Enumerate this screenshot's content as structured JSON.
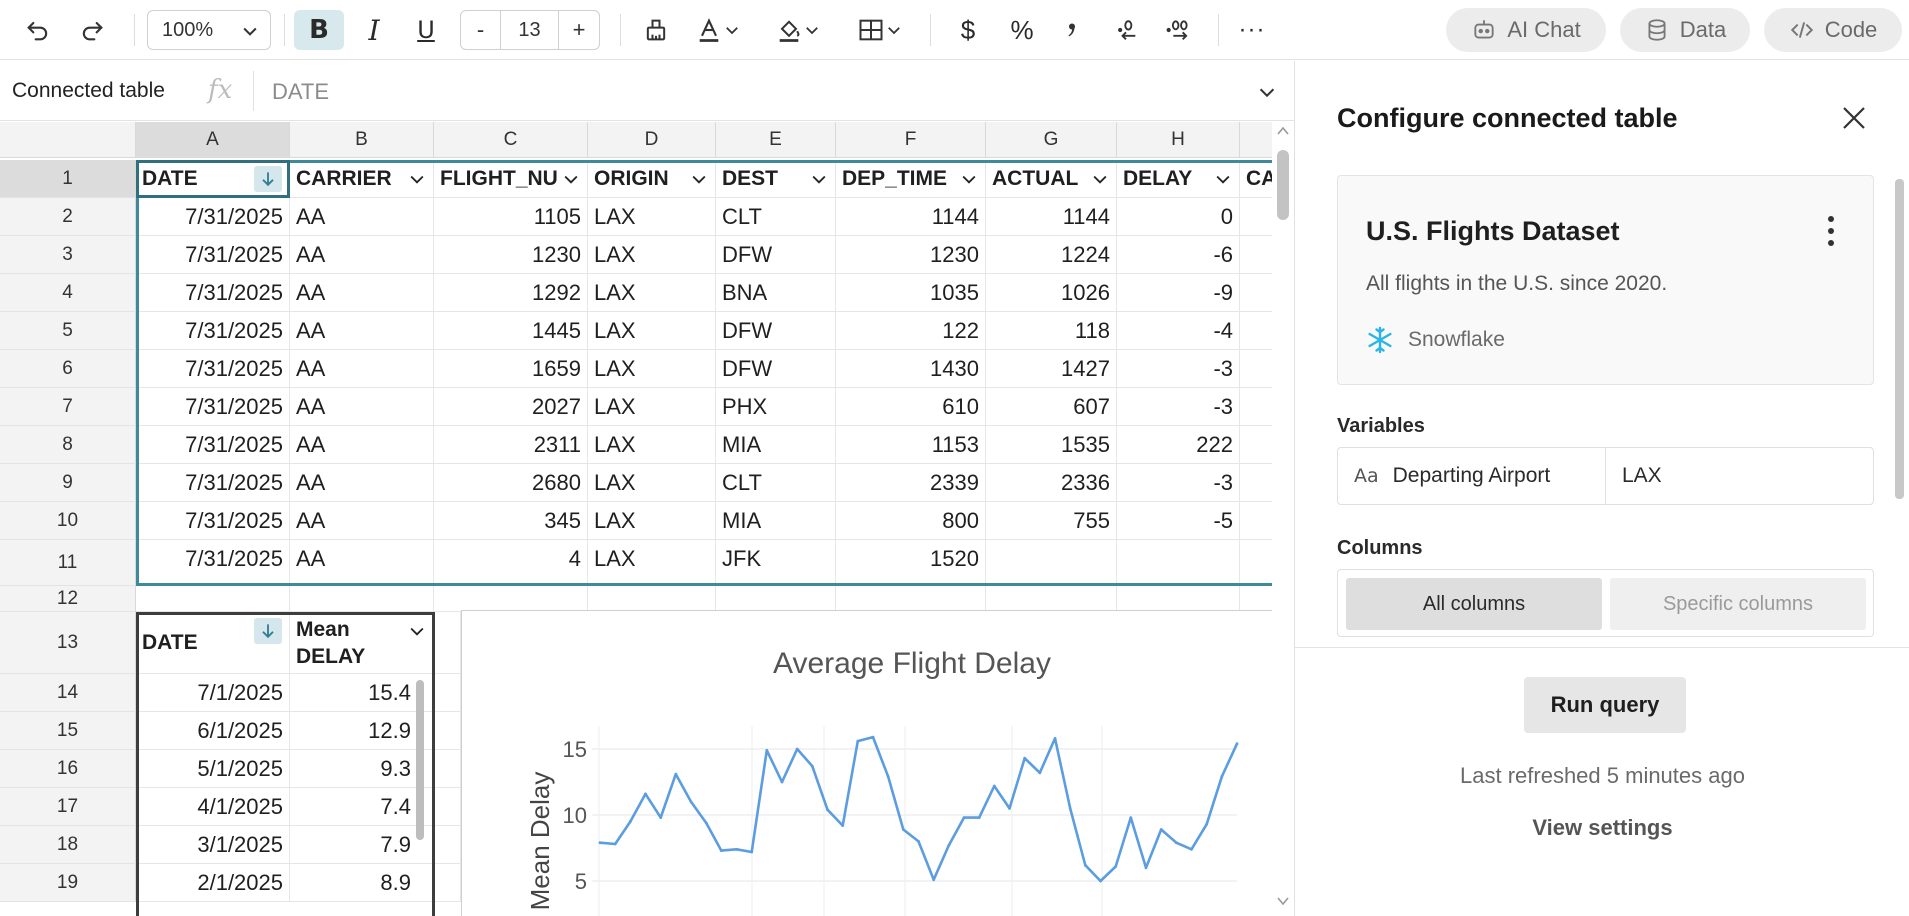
{
  "toolbar": {
    "zoom": "100%",
    "font_size": "13",
    "minus": "-",
    "plus": "+",
    "ai_chat": "AI Chat",
    "data": "Data",
    "code": "Code"
  },
  "formula_bar": {
    "name_box": "Connected table",
    "fx": "fx",
    "content": "DATE"
  },
  "columns": [
    "A",
    "B",
    "C",
    "D",
    "E",
    "F",
    "G",
    "H"
  ],
  "rows": [
    "1",
    "2",
    "3",
    "4",
    "5",
    "6",
    "7",
    "8",
    "9",
    "10",
    "11",
    "12",
    "13",
    "14",
    "15",
    "16",
    "17",
    "18",
    "19"
  ],
  "table1": {
    "headers": [
      "DATE",
      "CARRIER",
      "FLIGHT_NU",
      "ORIGIN",
      "DEST",
      "DEP_TIME",
      "ACTUAL",
      "DELAY",
      "CA"
    ],
    "rows": [
      [
        "7/31/2025",
        "AA",
        "1105",
        "LAX",
        "CLT",
        "1144",
        "1144",
        "0"
      ],
      [
        "7/31/2025",
        "AA",
        "1230",
        "LAX",
        "DFW",
        "1230",
        "1224",
        "-6"
      ],
      [
        "7/31/2025",
        "AA",
        "1292",
        "LAX",
        "BNA",
        "1035",
        "1026",
        "-9"
      ],
      [
        "7/31/2025",
        "AA",
        "1445",
        "LAX",
        "DFW",
        "122",
        "118",
        "-4"
      ],
      [
        "7/31/2025",
        "AA",
        "1659",
        "LAX",
        "DFW",
        "1430",
        "1427",
        "-3"
      ],
      [
        "7/31/2025",
        "AA",
        "2027",
        "LAX",
        "PHX",
        "610",
        "607",
        "-3"
      ],
      [
        "7/31/2025",
        "AA",
        "2311",
        "LAX",
        "MIA",
        "1153",
        "1535",
        "222"
      ],
      [
        "7/31/2025",
        "AA",
        "2680",
        "LAX",
        "CLT",
        "2339",
        "2336",
        "-3"
      ],
      [
        "7/31/2025",
        "AA",
        "345",
        "LAX",
        "MIA",
        "800",
        "755",
        "-5"
      ],
      [
        "7/31/2025",
        "AA",
        "4",
        "LAX",
        "JFK",
        "1520",
        "",
        ""
      ]
    ]
  },
  "table2": {
    "headers": [
      "DATE",
      "Mean DELAY"
    ],
    "header_b_line1": "Mean",
    "header_b_line2": "DELAY",
    "rows": [
      [
        "7/1/2025",
        "15.4"
      ],
      [
        "6/1/2025",
        "12.9"
      ],
      [
        "5/1/2025",
        "9.3"
      ],
      [
        "4/1/2025",
        "7.4"
      ],
      [
        "3/1/2025",
        "7.9"
      ],
      [
        "2/1/2025",
        "8.9"
      ]
    ]
  },
  "chart_data": {
    "type": "line",
    "title": "Average Flight Delay",
    "xlabel": "",
    "ylabel": "Mean Delay",
    "y_ticks": [
      5,
      10,
      15
    ],
    "ylim": [
      3,
      17
    ],
    "grid": true,
    "color": "#5b9de0",
    "series": [
      {
        "values": [
          7.9,
          7.8,
          9.5,
          11.6,
          9.8,
          13.1,
          11.0,
          9.4,
          7.3,
          7.4,
          7.2,
          14.9,
          12.5,
          15.0,
          13.7,
          10.4,
          9.2,
          15.6,
          15.9,
          12.9,
          8.9,
          8.0,
          5.1,
          7.7,
          9.8,
          9.8,
          12.2,
          10.5,
          14.3,
          13.2,
          15.8,
          10.5,
          6.2,
          5.0,
          6.1,
          9.8,
          6.0,
          8.9,
          7.9,
          7.4,
          9.3,
          12.9,
          15.4
        ]
      }
    ]
  },
  "panel": {
    "title": "Configure connected table",
    "dataset_title": "U.S. Flights Dataset",
    "dataset_desc": "All flights in the U.S. since 2020.",
    "dataset_source": "Snowflake",
    "variables_label": "Variables",
    "variable_type": "Aa",
    "variable_name": "Departing Airport",
    "variable_value": "LAX",
    "columns_label": "Columns",
    "seg_all": "All columns",
    "seg_specific": "Specific columns",
    "run_query": "Run query",
    "last_refreshed": "Last refreshed 5 minutes ago",
    "view_settings": "View settings"
  },
  "colors": {
    "accent": "#3e8a9c",
    "selection": "#d7e9ed",
    "snowflake": "#29b5e8"
  },
  "icons": [
    "undo-icon",
    "redo-icon",
    "bold-icon",
    "italic-icon",
    "underline-icon",
    "paint-format-icon",
    "text-color-icon",
    "fill-color-icon",
    "borders-icon",
    "currency-icon",
    "percent-icon",
    "comma-icon",
    "decrease-decimal-icon",
    "increase-decimal-icon",
    "more-icon",
    "robot-icon",
    "database-icon",
    "code-icon",
    "close-icon",
    "kebab-icon",
    "snowflake-icon",
    "sort-down-icon",
    "chevron-down-icon"
  ]
}
